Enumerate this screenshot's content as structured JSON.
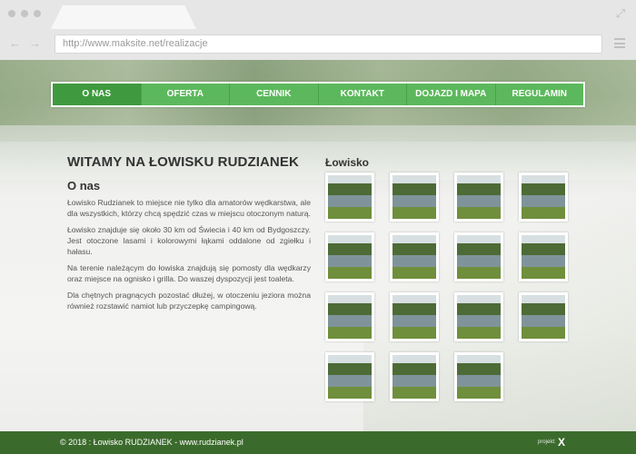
{
  "browser": {
    "url": "http://www.maksite.net/realizacje",
    "icons": [
      "expand-icon",
      "back-arrow-icon",
      "forward-arrow-icon",
      "hamburger-menu-icon"
    ]
  },
  "nav": {
    "items": [
      "O NAS",
      "OFERTA",
      "CENNIK",
      "KONTAKT",
      "DOJAZD I MAPA",
      "REGULAMIN"
    ],
    "active": "O NAS"
  },
  "main": {
    "title": "WITAMY NA ŁOWISKU RUDZIANEK",
    "subtitle": "O nas",
    "paragraphs": [
      "Łowisko Rudzianek to miejsce nie tylko dla amatorów wędkarstwa, ale dla wszystkich, którzy chcą spędzić czas w miejscu otoczonym naturą.",
      "Łowisko znajduje się około 30 km od Świecia i 40 km od Bydgoszczy. Jest otoczone lasami i kolorowymi łąkami oddalone od zgiełku i hałasu.",
      "Na terenie należącym do łowiska znajdują się pomosty dla wędkarzy oraz miejsce na ognisko i grilla. Do waszej dyspozycji jest toaleta.",
      "Dla chętnych pragnących pozostać dłużej, w otoczeniu jeziora można również rozstawić namiot lub przyczepkę campingową."
    ]
  },
  "gallery": {
    "title": "Łowisko",
    "count": 15
  },
  "footer": {
    "copyright": "© 2018 : Łowisko RUDZIANEK - www.rudzianek.pl",
    "project_label": "projekt:",
    "logo_text": "X"
  },
  "colors": {
    "nav_green": "#5cb85c",
    "nav_active": "#3f9a3f",
    "footer_green": "#3b6b2c"
  }
}
